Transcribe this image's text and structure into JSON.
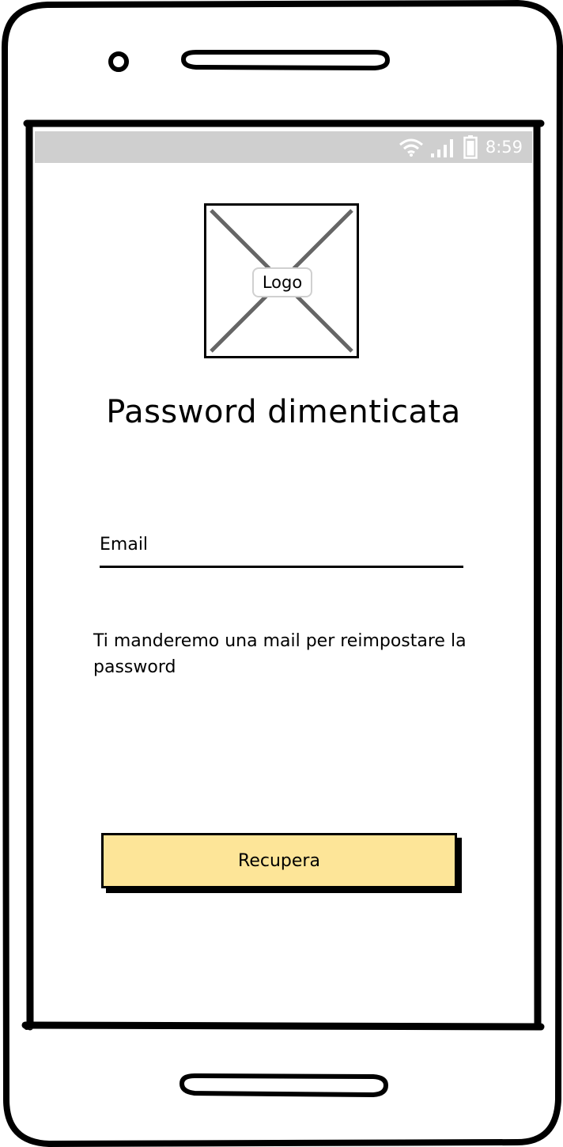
{
  "status_bar": {
    "time": "8:59",
    "icons": [
      "wifi-icon",
      "signal-icon",
      "battery-icon"
    ],
    "background": "#cfcfcf"
  },
  "logo": {
    "label": "Logo"
  },
  "page": {
    "title": "Password dimenticata"
  },
  "form": {
    "email_label": "Email",
    "helper_text": "Ti manderemo una mail per reimpostare la password",
    "submit_label": "Recupera",
    "submit_color": "#fde598"
  }
}
